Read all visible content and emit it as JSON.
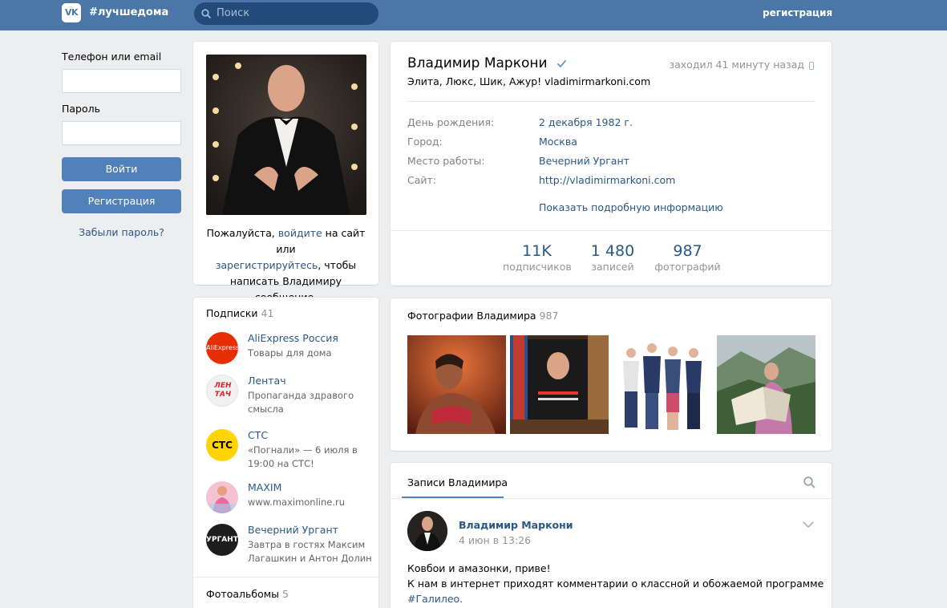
{
  "header": {
    "logo": "VK",
    "hashtag": "#лучшедома",
    "search_placeholder": "Поиск",
    "register_link": "регистрация"
  },
  "login": {
    "phone_label": "Телефон или email",
    "phone_value": "",
    "password_label": "Пароль",
    "password_value": "",
    "login_button": "Войти",
    "register_button": "Регистрация",
    "forgot_link": "Забыли пароль?"
  },
  "avatar_card": {
    "text_before": "Пожалуйста, ",
    "login_link": "войдите",
    "text_middle": " на сайт или",
    "register_link": "зарегистрируйтесь",
    "text_after": ", чтобы",
    "text_last": "написать Владимиру сообщение."
  },
  "subscriptions": {
    "title": "Подписки",
    "count": "41",
    "items": [
      {
        "name": "AliExpress Россия",
        "desc": "Товары для дома",
        "avatar_text": "AliExpress",
        "color": "#e62e04"
      },
      {
        "name": "Лентач",
        "desc": "Пропаганда здравого смысла",
        "avatar_text": "ЛЕН ТАЧ",
        "color": "#f1f1f1"
      },
      {
        "name": "СТС",
        "desc": "«Погнали» — 6 июля в 19:00 на СТС!",
        "avatar_text": "СТС",
        "color": "#ffd400"
      },
      {
        "name": "MAXIM",
        "desc": "www.maximonline.ru",
        "avatar_text": "",
        "color": "#f2a6c0"
      },
      {
        "name": "Вечерний Ургант",
        "desc": "Завтра в гостях Максим Лагашкин и Антон Долин",
        "avatar_text": "УРГАНТ",
        "color": "#1d1d1d"
      }
    ]
  },
  "albums": {
    "title": "Фотоальбомы",
    "count": "5"
  },
  "profile": {
    "name": "Владимир Маркони",
    "status": "Элита, Люкс, Шик, Ажур! vladimirmarkoni.com",
    "online": "заходил 41 минуту назад",
    "info": [
      {
        "label": "День рождения:",
        "value": "2 декабря 1982 г."
      },
      {
        "label": "Город:",
        "value": "Москва"
      },
      {
        "label": "Место работы:",
        "value": "Вечерний Ургант"
      },
      {
        "label": "Сайт:",
        "value": "http://vladimirmarkoni.com"
      }
    ],
    "more_link": "Показать подробную информацию",
    "counters": [
      {
        "num": "11K",
        "label": "подписчиков"
      },
      {
        "num": "1 480",
        "label": "записей"
      },
      {
        "num": "987",
        "label": "фотографий"
      }
    ]
  },
  "photos": {
    "title": "Фотографии Владимира",
    "count": "987"
  },
  "wall": {
    "tab": "Записи Владимира",
    "post": {
      "author": "Владимир Маркони",
      "date": "4 июн в 13:26",
      "line1": "Ковбои и амазонки, приве!",
      "line2": "К нам в интернет приходят комментарии о классной и обожаемой программе",
      "hashtag": "#Галилео."
    }
  },
  "colors": {
    "header": "#4a76a8",
    "accent": "#5181b8",
    "link": "#2a5885",
    "background": "#edeef0"
  }
}
